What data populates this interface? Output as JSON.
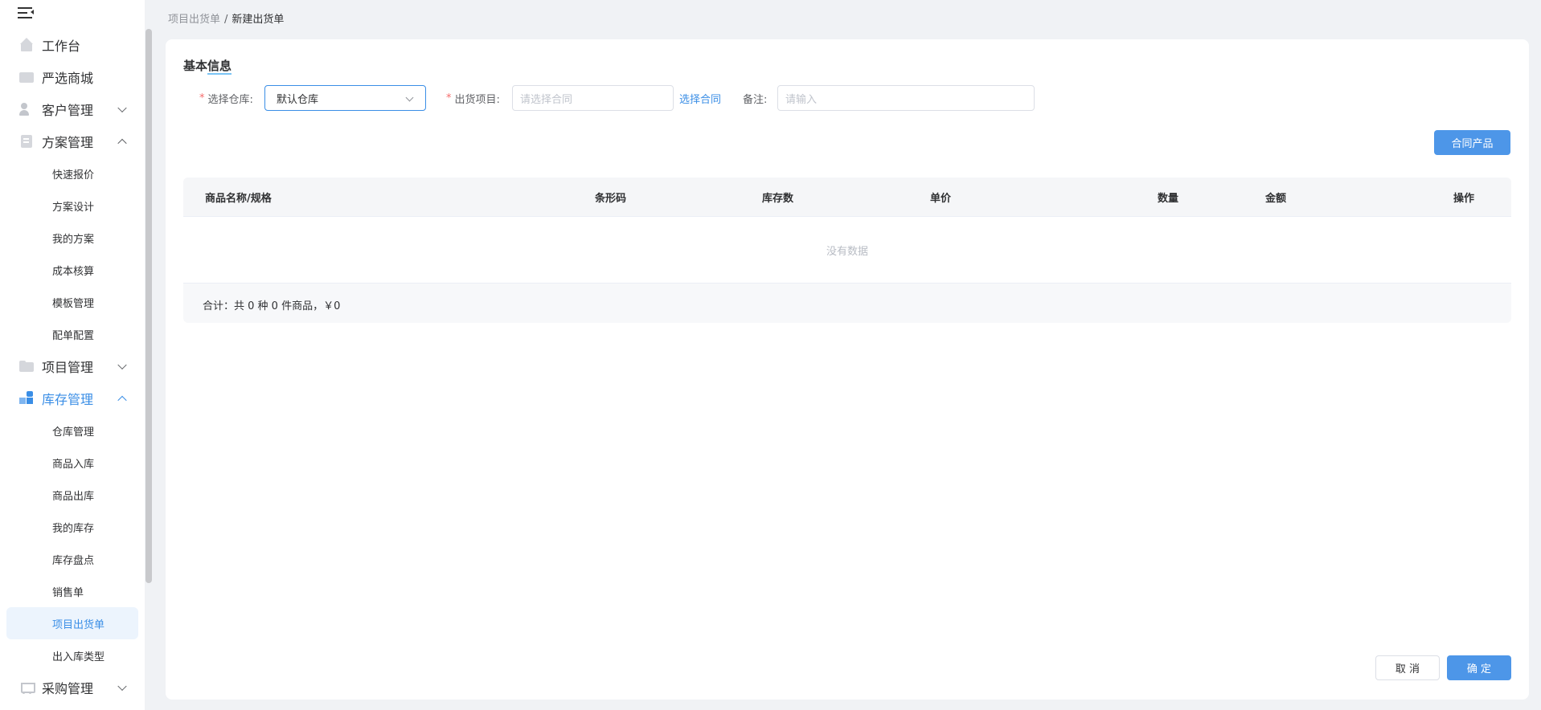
{
  "sidebar": {
    "menu": [
      {
        "label": "工作台",
        "icon": "home-icon",
        "arrow": ""
      },
      {
        "label": "严选商城",
        "icon": "shop-icon",
        "arrow": ""
      },
      {
        "label": "客户管理",
        "icon": "user-icon",
        "arrow": "down"
      },
      {
        "label": "方案管理",
        "icon": "document-icon",
        "arrow": "up"
      },
      {
        "label": "项目管理",
        "icon": "folder-icon",
        "arrow": "down"
      },
      {
        "label": "库存管理",
        "icon": "boxes-icon",
        "arrow": "up"
      },
      {
        "label": "采购管理",
        "icon": "cart-icon",
        "arrow": "down"
      }
    ],
    "plan_sub": [
      "快速报价",
      "方案设计",
      "我的方案",
      "成本核算",
      "模板管理",
      "配单配置"
    ],
    "stock_sub": [
      "仓库管理",
      "商品入库",
      "商品出库",
      "我的库存",
      "库存盘点",
      "销售单",
      "项目出货单",
      "出入库类型"
    ],
    "active_sub": "项目出货单"
  },
  "breadcrumb": {
    "parent": "项目出货单",
    "separator": "/",
    "current": "新建出货单"
  },
  "form": {
    "section_title_a": "基本",
    "section_title_b": "信息",
    "required_mark": "*",
    "warehouse_label": "选择仓库:",
    "warehouse_value": "默认仓库",
    "project_label": "出货项目:",
    "project_placeholder": "请选择合同",
    "choose_contract_link": "选择合同",
    "remark_label": "备注:",
    "remark_placeholder": "请输入"
  },
  "toolbar": {
    "contract_products_button": "合同产品"
  },
  "table": {
    "columns": [
      "商品名称/规格",
      "条形码",
      "库存数",
      "单价",
      "数量",
      "金额",
      "操作"
    ],
    "empty_text": "没有数据",
    "summary": "合计：共 0 种 0 件商品，￥0"
  },
  "actions": {
    "cancel": "取 消",
    "confirm": "确 定"
  },
  "colors": {
    "primary": "#3a8ee6",
    "required": "#f56c6c",
    "background": "#f0f2f5"
  }
}
